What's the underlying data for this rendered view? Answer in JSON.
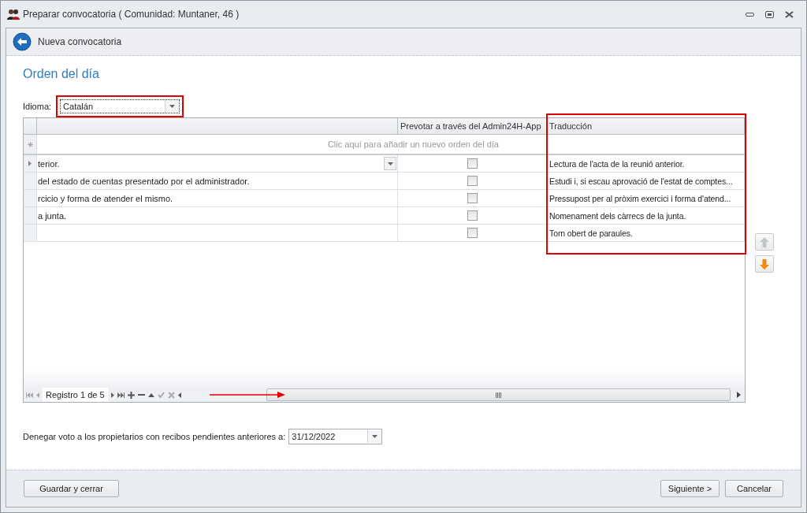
{
  "window": {
    "title": "Preparar convocatoria ( Comunidad: Muntaner, 46 )"
  },
  "header": {
    "title": "Nueva convocatoria"
  },
  "section_title": "Orden del día",
  "language": {
    "label": "Idioma:",
    "value": "Catalán"
  },
  "table": {
    "columns": [
      "",
      "Prevotar a través del Admin24H-App",
      "Traducción"
    ],
    "new_row_hint": "Clic aquí para añadir un nuevo orden del día",
    "rows": [
      {
        "text": "terior.",
        "prevote": false,
        "translation": "Lectura de l'acta de la reunió anterior.",
        "selected": true
      },
      {
        "text": "del estado de cuentas presentado por el administrador.",
        "prevote": false,
        "translation": "Estudi i, si escau aprovació de l'estat de comptes...",
        "selected": false
      },
      {
        "text": "rcicio y forma de atender el mismo.",
        "prevote": false,
        "translation": "Pressupost per al pròxim exercici i forma d'atend...",
        "selected": false
      },
      {
        "text": "a junta.",
        "prevote": false,
        "translation": "Nomenament dels càrrecs de la junta.",
        "selected": false
      },
      {
        "text": "",
        "prevote": false,
        "translation": "Torn obert de paraules.",
        "selected": false
      }
    ],
    "navigator": {
      "record": "Registro 1 de 5"
    }
  },
  "deny_vote": {
    "label": "Denegar voto a los propietarios con recibos pendientes anteriores a:",
    "value": "31/12/2022"
  },
  "buttons": {
    "save": "Guardar y cerrar",
    "next": "Siguiente >",
    "cancel": "Cancelar"
  }
}
